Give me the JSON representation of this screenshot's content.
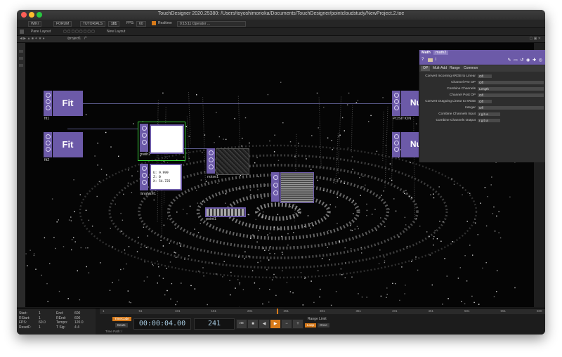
{
  "window": {
    "title": "TouchDesigner 2020.25380: /Users/toyoshimorioka/Documents/TouchDesigner/pointcloudstudy/NewProject.2.toe"
  },
  "menubar": {
    "items": [
      "WIKI",
      "FORUM",
      "TUTORIALS"
    ],
    "fps_label": "FPS:",
    "fps_value": "60",
    "realtime": "Realtime",
    "message": "0:15:11 Operator ...",
    "badge": "101"
  },
  "toolbar": {
    "pane_layout": "Pane Layout",
    "new_layout": "New Layout"
  },
  "pathbar": {
    "path": "/project1",
    "suffix": "/*"
  },
  "nodes": {
    "fit1": {
      "title": "Fit",
      "name": "fit1"
    },
    "fit2": {
      "title": "Fit",
      "name": "fit2"
    },
    "math2": {
      "name": "math2"
    },
    "analyze": {
      "name": "analyze1",
      "line1": "U: 9.999",
      "line2": "Z: 0",
      "line3": "X: 54.725"
    },
    "noise": {
      "name": "noise1"
    },
    "null1": {
      "title": "Nul",
      "name": "POSITION"
    },
    "null2": {
      "title": "Nul"
    },
    "strip": {
      "name": "point1"
    }
  },
  "params": {
    "type": "Math",
    "name": "math2",
    "tabs": [
      "OP",
      "Mult-Add",
      "Range",
      "Common"
    ],
    "rows": [
      {
        "label": "Convert Incoming sRGB to Linear",
        "value": "Off"
      },
      {
        "label": "Channel Pre OP",
        "value": "Off"
      },
      {
        "label": "Combine Channels",
        "value": "Length"
      },
      {
        "label": "Channel Post OP",
        "value": "Off"
      },
      {
        "label": "Convert Outgoing Linear to sRGB",
        "value": "Off"
      },
      {
        "label": "Integer",
        "value": "Off"
      },
      {
        "label": "Combine Channels Input",
        "value": "r  g  b  a"
      },
      {
        "label": "Combine Channels Output",
        "value": "r  g  b  a"
      }
    ]
  },
  "timeline": {
    "stats": [
      {
        "k": "Start:",
        "v": "1"
      },
      {
        "k": "RStart:",
        "v": "1"
      },
      {
        "k": "FPS:",
        "v": "60.0"
      },
      {
        "k": "ResetF:",
        "v": "1"
      },
      {
        "k": "End:",
        "v": "600"
      },
      {
        "k": "REnd:",
        "v": "600"
      },
      {
        "k": "Tempo:",
        "v": "120.0"
      },
      {
        "k": "T Sig:",
        "v": "4    4"
      }
    ],
    "timecode_label": "TimeCode",
    "beats_label": "Beats",
    "timecode": "00:00:04.00",
    "frame": "241",
    "range_limit": "Range Limit",
    "loop": "Loop",
    "once": "Once",
    "time_path": "Time Path: /",
    "ticks": [
      "1",
      "51",
      "101",
      "151",
      "201",
      "251",
      "301",
      "351",
      "401",
      "451",
      "501",
      "551",
      "600"
    ]
  },
  "colors": {
    "op_purple": "#6c5aa8",
    "accent_orange": "#d77a1a",
    "timecode_text": "#a9cde3",
    "selected_green": "#39d23a"
  }
}
